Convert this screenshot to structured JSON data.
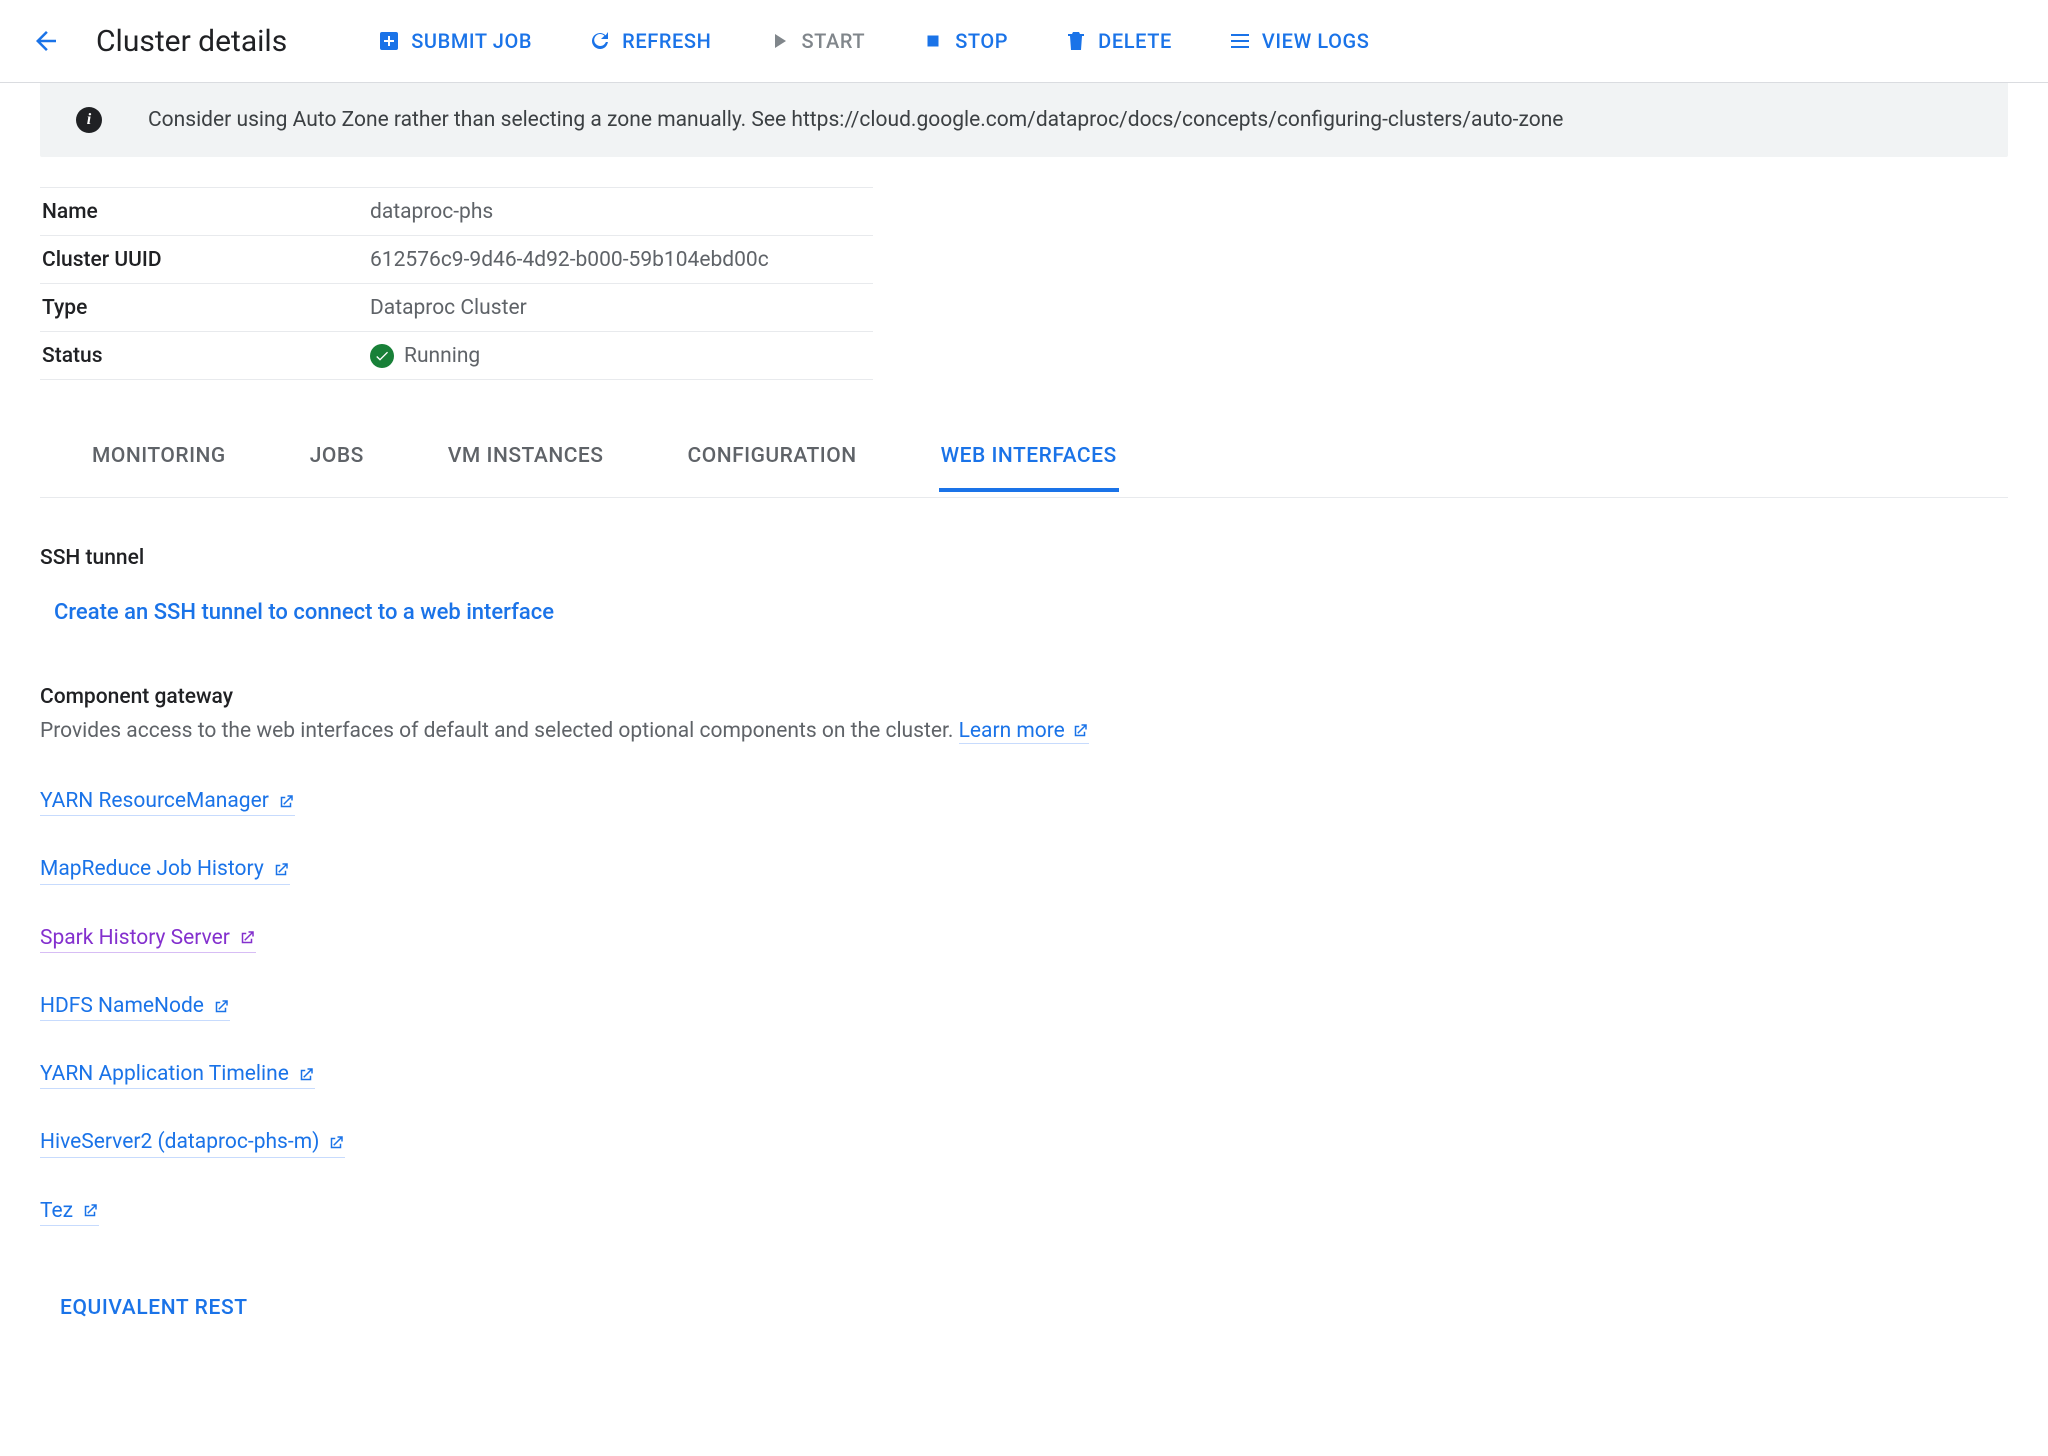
{
  "header": {
    "title": "Cluster details",
    "actions": {
      "submit": "SUBMIT JOB",
      "refresh": "REFRESH",
      "start": "START",
      "stop": "STOP",
      "delete": "DELETE",
      "viewlogs": "VIEW LOGS"
    }
  },
  "banner": {
    "text": "Consider using Auto Zone rather than selecting a zone manually. See https://cloud.google.com/dataproc/docs/concepts/configuring-clusters/auto-zone"
  },
  "props": {
    "name_label": "Name",
    "name_value": "dataproc-phs",
    "uuid_label": "Cluster UUID",
    "uuid_value": "612576c9-9d46-4d92-b000-59b104ebd00c",
    "type_label": "Type",
    "type_value": "Dataproc Cluster",
    "status_label": "Status",
    "status_value": "Running"
  },
  "tabs": {
    "monitoring": "MONITORING",
    "jobs": "JOBS",
    "vm": "VM INSTANCES",
    "config": "CONFIGURATION",
    "web": "WEB INTERFACES"
  },
  "ssh": {
    "title": "SSH tunnel",
    "create_link": "Create an SSH tunnel to connect to a web interface"
  },
  "gateway": {
    "title": "Component gateway",
    "desc": "Provides access to the web interfaces of default and selected optional components on the cluster. ",
    "learn_more": "Learn more",
    "links": {
      "yarn_rm": "YARN ResourceManager",
      "mr_hist": "MapReduce Job History",
      "spark_hist": "Spark History Server",
      "hdfs": "HDFS NameNode",
      "yarn_tl": "YARN Application Timeline",
      "hive": "HiveServer2 (dataproc-phs-m)",
      "tez": "Tez"
    }
  },
  "footer": {
    "equiv_rest": "EQUIVALENT REST"
  }
}
